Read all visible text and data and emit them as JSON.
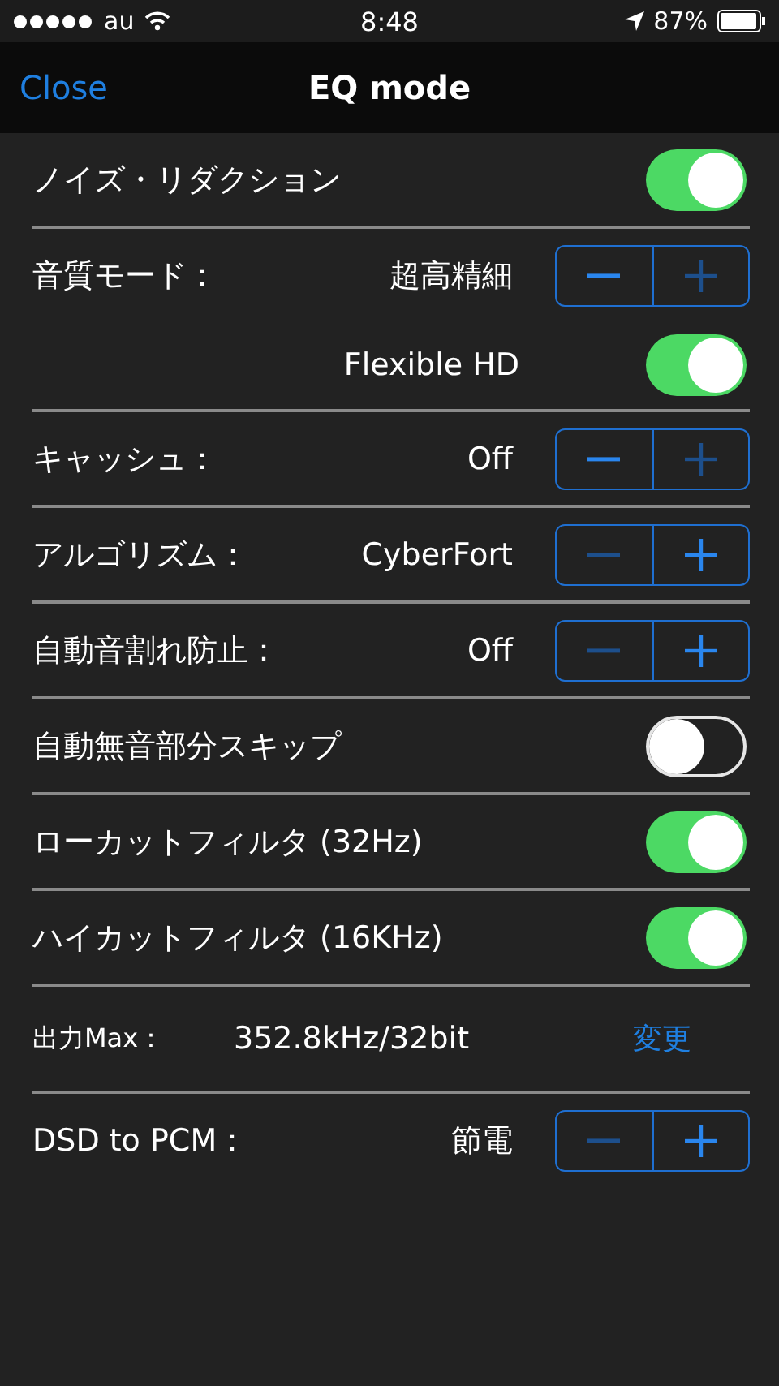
{
  "status_bar": {
    "carrier": "au",
    "time": "8:48",
    "battery": "87%"
  },
  "nav": {
    "back": "Close",
    "title": "EQ mode"
  },
  "rows": [
    {
      "kind": "toggle",
      "label": "ノイズ・リダクション",
      "on": true
    },
    {
      "kind": "stepper",
      "label": "音質モード：",
      "value": "超高精細",
      "minus_disabled": false,
      "plus_disabled": true,
      "sub_toggle": {
        "label": "Flexible HD",
        "on": true
      }
    },
    {
      "kind": "stepper",
      "label": "キャッシュ：",
      "value": "Off",
      "minus_disabled": false,
      "plus_disabled": true
    },
    {
      "kind": "stepper",
      "label": "アルゴリズム：",
      "value": "CyberFort",
      "minus_disabled": true,
      "plus_disabled": false
    },
    {
      "kind": "stepper",
      "label": "自動音割れ防止：",
      "value": "Off",
      "minus_disabled": true,
      "plus_disabled": false
    },
    {
      "kind": "toggle",
      "label": "自動無音部分スキップ",
      "on": false
    },
    {
      "kind": "toggle",
      "label": "ローカットフィルタ (32Hz)",
      "on": true
    },
    {
      "kind": "toggle",
      "label": "ハイカットフィルタ (16KHz)",
      "on": true
    },
    {
      "kind": "info",
      "label": "出力Max：",
      "value": "352.8kHz/32bit",
      "action": "変更"
    },
    {
      "kind": "stepper",
      "label": "DSD to PCM：",
      "value": "節電",
      "minus_disabled": true,
      "plus_disabled": false
    }
  ]
}
